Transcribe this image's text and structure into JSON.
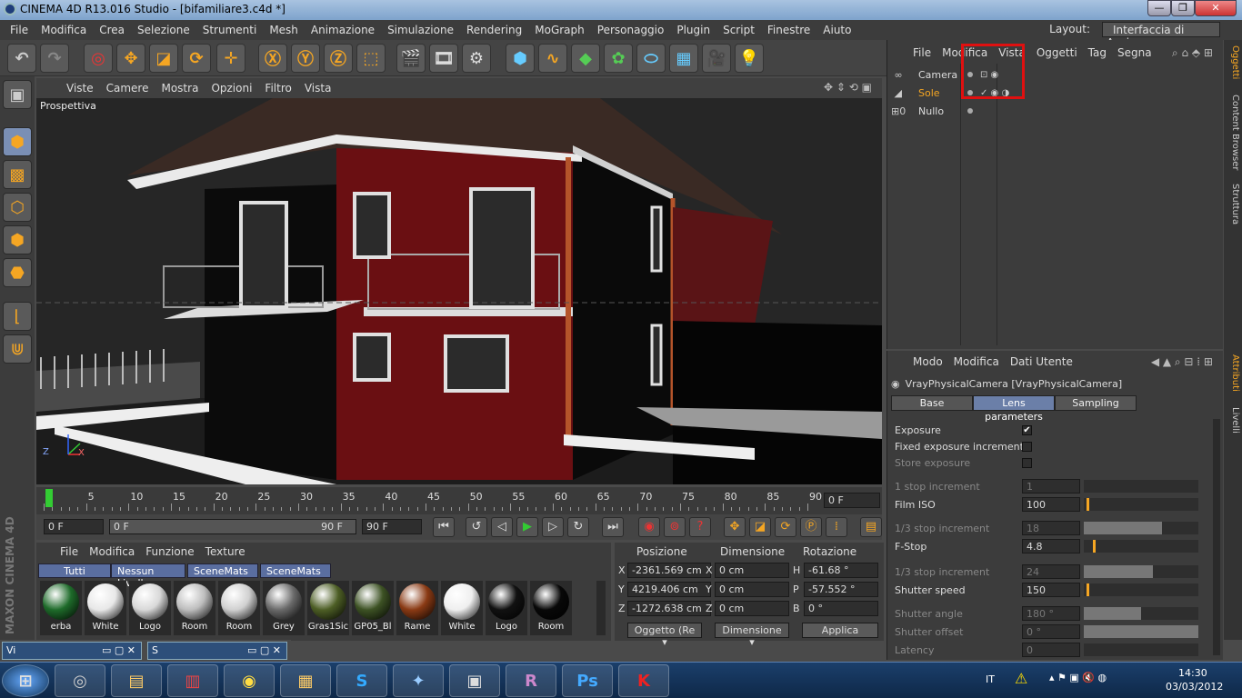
{
  "window": {
    "title": "CINEMA 4D R13.016 Studio - [bifamiliare3.c4d *]",
    "buttons": [
      "—",
      "❐",
      "✕"
    ]
  },
  "menu": [
    "File",
    "Modifica",
    "Crea",
    "Selezione",
    "Strumenti",
    "Mesh",
    "Animazione",
    "Simulazione",
    "Rendering",
    "MoGraph",
    "Personaggio",
    "Plugin",
    "Script",
    "Finestre",
    "Aiuto"
  ],
  "layout": {
    "label": "Layout:",
    "value": "Interfaccia di Avvio"
  },
  "viewport": {
    "menu": [
      "Viste",
      "Camere",
      "Mostra",
      "Opzioni",
      "Filtro",
      "Vista"
    ],
    "name": "Prospettiva",
    "axis_z": "Z",
    "axis_x": "X"
  },
  "timeline": {
    "ticks": [
      "0",
      "5",
      "10",
      "15",
      "20",
      "25",
      "30",
      "35",
      "40",
      "45",
      "50",
      "55",
      "60",
      "65",
      "70",
      "75",
      "80",
      "85",
      "90"
    ],
    "current": "0 F"
  },
  "controls": {
    "start": "0 F",
    "range_start": "0 F",
    "range_end": "90 F",
    "end": "90 F"
  },
  "materials": {
    "menu": [
      "File",
      "Modifica",
      "Funzione",
      "Texture"
    ],
    "tabs": [
      "Tutti",
      "Nessun Livello",
      "SceneMats",
      "SceneMats"
    ],
    "items": [
      {
        "label": "erba",
        "color": "#1e6b2a"
      },
      {
        "label": "White",
        "color": "#e8e8e8"
      },
      {
        "label": "Logo",
        "color": "#d8d8d8"
      },
      {
        "label": "Room",
        "color": "#bdbdbd"
      },
      {
        "label": "Room",
        "color": "#d0d0d0"
      },
      {
        "label": "Grey",
        "color": "#6a6a6a"
      },
      {
        "label": "Gras1Sic",
        "color": "#4d5e25"
      },
      {
        "label": "GP05_Bl",
        "color": "#3d5224"
      },
      {
        "label": "Rame",
        "color": "#8a3a14"
      },
      {
        "label": "White",
        "color": "#efefef"
      },
      {
        "label": "Logo",
        "color": "#111111"
      },
      {
        "label": "Room",
        "color": "#080808"
      }
    ]
  },
  "coords": {
    "headers": [
      "Posizione",
      "Dimensione",
      "Rotazione"
    ],
    "rows": [
      {
        "axis": "X",
        "pos": "-2361.569 cm",
        "dim": "0 cm",
        "rot_label": "H",
        "rot": "-61.68 °"
      },
      {
        "axis": "Y",
        "pos": "4219.406 cm",
        "dim": "0 cm",
        "rot_label": "P",
        "rot": "-57.552 °"
      },
      {
        "axis": "Z",
        "pos": "-1272.638 cm",
        "dim": "0 cm",
        "rot_label": "B",
        "rot": "0 °"
      }
    ],
    "mode": "Oggetto (Re",
    "size_mode": "Dimensione",
    "apply": "Applica"
  },
  "taskmini": [
    {
      "label": "Vi"
    },
    {
      "label": "S"
    }
  ],
  "objects": {
    "menu": [
      "File",
      "Modifica",
      "Vista",
      "Oggetti",
      "Tag",
      "Segna"
    ],
    "items": [
      {
        "name": "Camera",
        "color": "#e6e6e6"
      },
      {
        "name": "Sole",
        "color": "#f5a623"
      },
      {
        "name": "Nullo",
        "color": "#e6e6e6"
      }
    ]
  },
  "attributes": {
    "menu": [
      "Modo",
      "Modifica",
      "Dati Utente"
    ],
    "object": "VrayPhysicalCamera [VrayPhysicalCamera]",
    "tabs": [
      "Base",
      "Lens parameters",
      "Sampling"
    ],
    "active_tab": "Lens parameters",
    "params": [
      {
        "label": "Exposure",
        "type": "check",
        "checked": "✔",
        "dim": false
      },
      {
        "label": "Fixed exposure increments",
        "type": "check",
        "checked": "",
        "dim": false
      },
      {
        "label": "Store exposure",
        "type": "check",
        "checked": "",
        "dim": true
      },
      {
        "label": "1 stop increment",
        "value": "1",
        "dim": true,
        "level": 0
      },
      {
        "label": "Film ISO",
        "value": "100",
        "dim": false,
        "level": 0.02
      },
      {
        "label": "1/3 stop increment",
        "value": "18",
        "dim": true,
        "level": 0.68
      },
      {
        "label": "F-Stop",
        "value": "4.8",
        "dim": false,
        "level": 0.08
      },
      {
        "label": "1/3 stop increment",
        "value": "24",
        "dim": true,
        "level": 0.6
      },
      {
        "label": "Shutter speed",
        "value": "150",
        "dim": false,
        "level": 0.02
      },
      {
        "label": "Shutter angle",
        "value": "180 °",
        "dim": true,
        "level": 0.5
      },
      {
        "label": "Shutter offset",
        "value": "0 °",
        "dim": true,
        "level": 1
      },
      {
        "label": "Latency",
        "value": "0",
        "dim": true,
        "level": 0
      }
    ]
  },
  "sidetabs": [
    "Oggetti",
    "Content Browser",
    "Struttura",
    "Attributi",
    "Livelli"
  ],
  "taskbar": {
    "lang": "IT",
    "time": "14:30",
    "date": "03/03/2012"
  }
}
